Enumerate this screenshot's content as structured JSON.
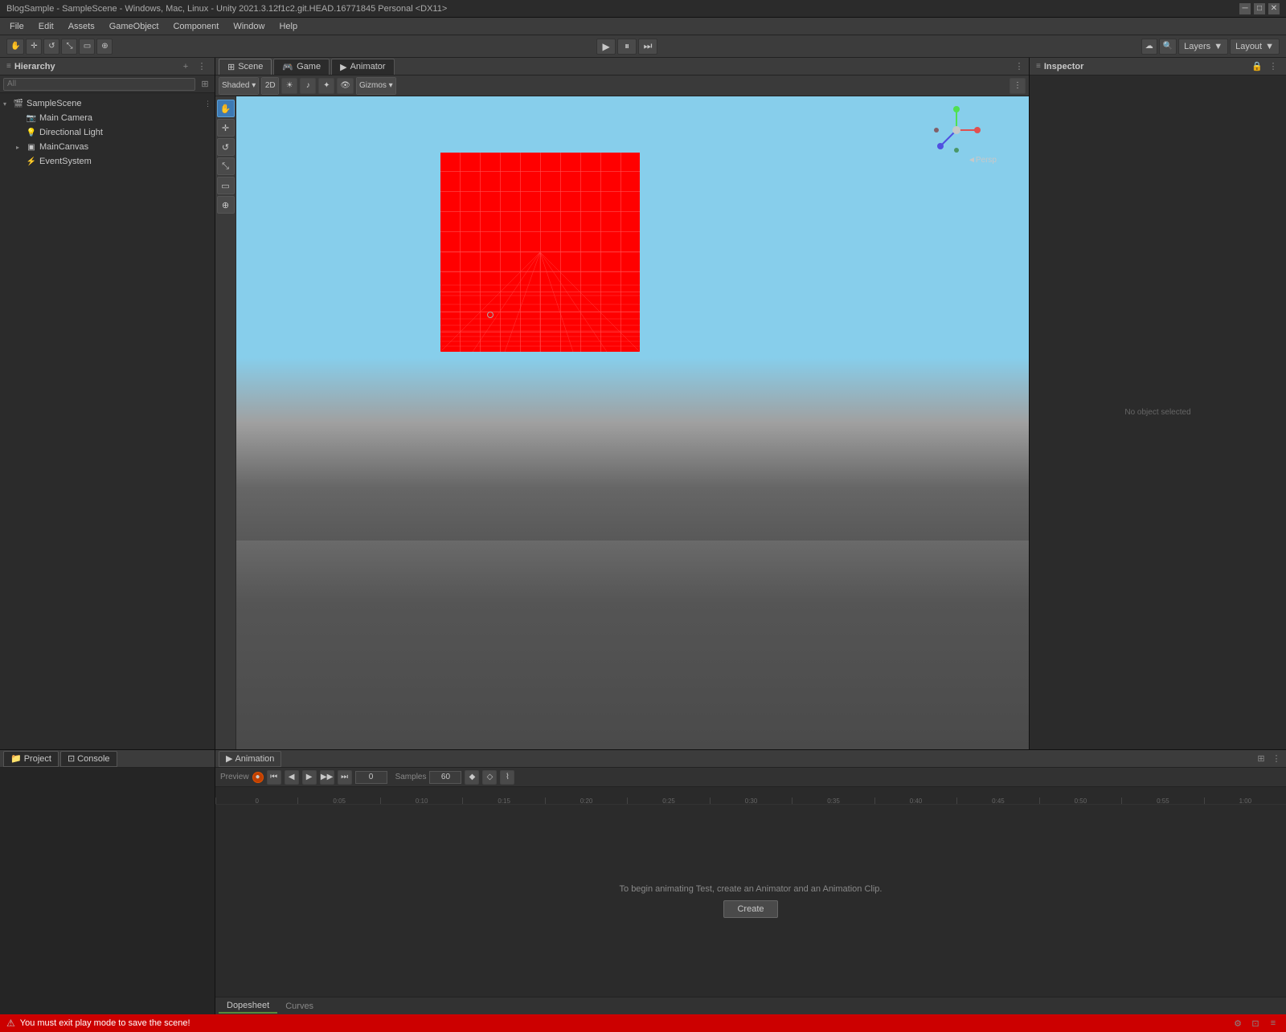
{
  "window": {
    "title": "BlogSample - SampleScene - Windows, Mac, Linux - Unity 2021.3.12f1c2.git.HEAD.16771845 Personal <DX11>"
  },
  "menu": {
    "items": [
      "File",
      "Edit",
      "Assets",
      "GameObject",
      "Component",
      "Window",
      "Help"
    ]
  },
  "toolbar": {
    "play_label": "▶",
    "pause_label": "⏸",
    "step_label": "⏭",
    "layers_label": "Layers",
    "layout_label": "Layout"
  },
  "hierarchy": {
    "title": "Hierarchy",
    "search_placeholder": "All",
    "items": [
      {
        "name": "SampleScene",
        "type": "scene",
        "depth": 0,
        "expanded": true
      },
      {
        "name": "Main Camera",
        "type": "camera",
        "depth": 1
      },
      {
        "name": "Directional Light",
        "type": "light",
        "depth": 1
      },
      {
        "name": "MainCanvas",
        "type": "canvas",
        "depth": 1
      },
      {
        "name": "EventSystem",
        "type": "eventsystem",
        "depth": 1
      }
    ]
  },
  "scene_tabs": [
    {
      "label": "Scene",
      "icon": "scene",
      "active": true
    },
    {
      "label": "Game",
      "icon": "game",
      "active": false
    },
    {
      "label": "Animator",
      "icon": "animator",
      "active": false
    }
  ],
  "inspector": {
    "title": "Inspector"
  },
  "bottom_tabs": [
    {
      "label": "Project",
      "icon": "folder",
      "active": false
    },
    {
      "label": "Console",
      "icon": "console",
      "active": false
    },
    {
      "label": "Animation",
      "icon": "anim",
      "active": true
    }
  ],
  "animation": {
    "preview_label": "Preview",
    "samples_label": "Samples",
    "samples_value": "60",
    "frame_value": "0",
    "create_text": "To begin animating Test, create an Animator and an Animation Clip.",
    "create_btn": "Create",
    "sub_tabs": [
      {
        "label": "Dopesheet",
        "active": true
      },
      {
        "label": "Curves",
        "active": false
      }
    ]
  },
  "status_bar": {
    "message": "You must exit play mode to save the scene!",
    "icon": "⚠"
  },
  "gizmo": {
    "persp_label": "◄Persp"
  },
  "timeline": {
    "ticks": [
      "0:05",
      "0:10",
      "0:15",
      "0:20",
      "0:25",
      "0:30",
      "0:35",
      "0:40",
      "0:45",
      "0:50",
      "0:55",
      "1:00"
    ]
  }
}
